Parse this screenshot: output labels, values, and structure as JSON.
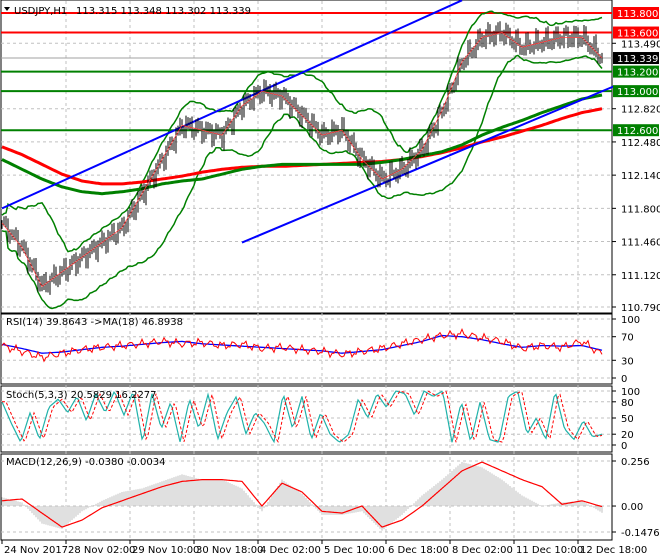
{
  "header": {
    "symbol_label": "USDJPY,H1",
    "ohlc": "113.315 113.348 113.302 113.339"
  },
  "colors": {
    "up_res": "#ff0000",
    "support": "#008000",
    "channel": "#0000ff",
    "ma_slow": "#ff0000",
    "ma_fast": "#008000",
    "bollinger": "#008000",
    "rsi": "#ff0000",
    "rsi_ma": "#0000ff",
    "stoch_main": "#20b2aa",
    "stoch_signal": "#ff0000",
    "macd_hist": "#c0c0c0",
    "macd_signal": "#ff0000"
  },
  "chart_data": [
    {
      "type": "line",
      "title": "USDJPY,H1",
      "bar_step": 10,
      "closes": [
        111.65,
        111.4,
        111.0,
        111.15,
        111.3,
        111.45,
        111.6,
        111.95,
        112.3,
        112.65,
        112.6,
        112.55,
        112.85,
        113.0,
        112.95,
        112.75,
        112.55,
        112.6,
        112.3,
        112.1,
        112.2,
        112.4,
        112.8,
        113.3,
        113.55,
        113.6,
        113.45,
        113.5,
        113.55,
        113.55,
        113.339
      ],
      "ma_slow": [
        112.43,
        112.35,
        112.25,
        112.15,
        112.08,
        112.05,
        112.05,
        112.07,
        112.1,
        112.13,
        112.17,
        112.2,
        112.22,
        112.23,
        112.23,
        112.24,
        112.25,
        112.26,
        112.27,
        112.28,
        112.3,
        112.33,
        112.37,
        112.42,
        112.48,
        112.53,
        112.59,
        112.65,
        112.72,
        112.78,
        112.82
      ],
      "ma_fast": [
        112.3,
        112.2,
        112.1,
        112.02,
        111.97,
        111.95,
        111.97,
        112.0,
        112.05,
        112.08,
        112.1,
        112.15,
        112.2,
        112.23,
        112.25,
        112.25,
        112.25,
        112.25,
        112.25,
        112.27,
        112.3,
        112.34,
        112.38,
        112.45,
        112.55,
        112.63,
        112.7,
        112.78,
        112.85,
        112.92,
        112.96
      ],
      "levels": [
        {
          "price": 113.8,
          "label": "113.800",
          "kind": "resistance"
        },
        {
          "price": 113.6,
          "label": "113.600",
          "kind": "resistance"
        },
        {
          "price": 113.2,
          "label": "113.200",
          "kind": "support"
        },
        {
          "price": 113.0,
          "label": "113.000",
          "kind": "support"
        },
        {
          "price": 112.6,
          "label": "112.600",
          "kind": "support"
        }
      ],
      "current_price": {
        "price": 113.339,
        "label": "113.339"
      },
      "channel": {
        "upper": [
          [
            0,
            111.8
          ],
          [
            230,
            113.93
          ]
        ],
        "lower": [
          [
            120,
            111.45
          ],
          [
            306,
            113.05
          ]
        ]
      },
      "y_ticks": [
        {
          "v": 113.49,
          "label": "113.490"
        },
        {
          "v": 112.82,
          "label": "112.820"
        },
        {
          "v": 112.48,
          "label": "112.480"
        },
        {
          "v": 112.14,
          "label": "112.140"
        },
        {
          "v": 111.8,
          "label": "111.800"
        },
        {
          "v": 111.46,
          "label": "111.460"
        },
        {
          "v": 111.12,
          "label": "111.120"
        },
        {
          "v": 110.79,
          "label": "110.790"
        }
      ],
      "ylim": [
        110.79,
        113.8
      ]
    },
    {
      "type": "line",
      "title": "RSI(14) 39.8643  ->MA(18) 46.8938",
      "rsi": [
        55,
        45,
        35,
        42,
        48,
        52,
        55,
        58,
        62,
        58,
        60,
        55,
        57,
        50,
        52,
        48,
        45,
        40,
        45,
        50,
        58,
        65,
        72,
        75,
        68,
        62,
        50,
        55,
        52,
        62,
        40
      ],
      "ma": [
        57,
        50,
        42,
        44,
        48,
        52,
        54,
        57,
        60,
        62,
        58,
        56,
        54,
        52,
        50,
        48,
        46,
        42,
        45,
        48,
        55,
        62,
        72,
        70,
        65,
        58,
        52,
        55,
        54,
        55,
        47
      ],
      "y_ticks": [
        {
          "v": 100,
          "label": "100"
        },
        {
          "v": 70,
          "label": "70"
        },
        {
          "v": 30,
          "label": "30"
        },
        {
          "v": 0,
          "label": "0"
        }
      ],
      "ylim": [
        0,
        100
      ]
    },
    {
      "type": "line",
      "title": "Stoch(5,3,3) 20.5829 16.2277",
      "main": [
        80,
        40,
        5,
        60,
        10,
        70,
        85,
        60,
        90,
        45,
        95,
        60,
        100,
        55,
        100,
        5,
        95,
        30,
        80,
        5,
        85,
        30,
        95,
        10,
        60,
        90,
        20,
        60,
        40,
        5,
        95,
        30,
        90,
        10,
        60,
        20,
        5,
        20,
        85,
        50,
        95,
        70,
        100,
        95,
        55,
        100,
        90,
        100,
        5,
        80,
        5,
        80,
        10,
        5,
        90,
        100,
        20,
        50,
        10,
        100,
        30,
        10,
        45,
        15,
        20
      ],
      "y_ticks": [
        {
          "v": 100,
          "label": "100"
        },
        {
          "v": 80,
          "label": "80"
        },
        {
          "v": 50,
          "label": "50"
        },
        {
          "v": 20,
          "label": "20"
        },
        {
          "v": 0,
          "label": "0"
        }
      ],
      "ylim": [
        0,
        100
      ]
    },
    {
      "type": "bar",
      "title": "MACD(12,26,9) -0.0380 -0.0034",
      "hist": [
        0.05,
        0.02,
        -0.1,
        -0.13,
        -0.03,
        0.03,
        0.08,
        0.1,
        0.14,
        0.18,
        0.15,
        0.15,
        0.1,
        -0.03,
        0.15,
        0.07,
        -0.05,
        -0.05,
        -0.03,
        -0.14,
        -0.05,
        0.06,
        0.15,
        0.25,
        0.22,
        0.15,
        0.06,
        0.0,
        0.02,
        0.03,
        -0.038
      ],
      "signal": [
        0.03,
        0.04,
        -0.04,
        -0.12,
        -0.08,
        -0.01,
        0.03,
        0.07,
        0.11,
        0.14,
        0.15,
        0.15,
        0.14,
        0.0,
        0.13,
        0.08,
        -0.03,
        -0.04,
        0.0,
        -0.12,
        -0.08,
        0.0,
        0.1,
        0.2,
        0.25,
        0.2,
        0.15,
        0.11,
        0.01,
        0.03,
        -0.0034
      ],
      "y_ticks": [
        {
          "v": 0.256,
          "label": "0.256"
        },
        {
          "v": 0,
          "label": "0.00"
        },
        {
          "v": -0.1476,
          "label": "-0.1476"
        }
      ],
      "ylim": [
        -0.1476,
        0.256
      ]
    }
  ],
  "x_ticks": [
    "24 Nov 2017",
    "28 Nov 02:00",
    "29 Nov 10:00",
    "30 Nov 18:00",
    "4 Dec 02:00",
    "5 Dec 10:00",
    "6 Dec 18:00",
    "8 Dec 02:00",
    "11 Dec 10:00",
    "12 Dec 18:00"
  ]
}
